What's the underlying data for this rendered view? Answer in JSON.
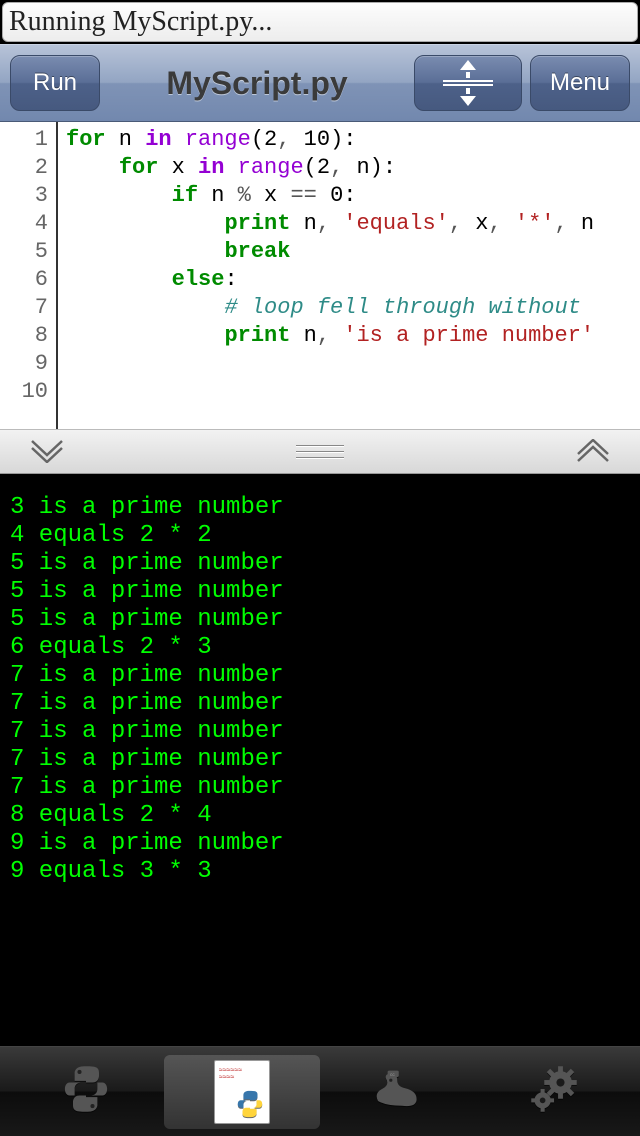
{
  "status_text": "Running MyScript.py...",
  "toolbar": {
    "run_label": "Run",
    "title": "MyScript.py",
    "menu_label": "Menu"
  },
  "editor": {
    "line_count": 10,
    "code_tokens": [
      [
        [
          "kw",
          "for"
        ],
        [
          "",
          " n "
        ],
        [
          "kw2",
          "in"
        ],
        [
          "",
          " "
        ],
        [
          "builtin",
          "range"
        ],
        [
          "",
          "("
        ],
        [
          "num",
          "2"
        ],
        [
          "op",
          ", "
        ],
        [
          "num",
          "10"
        ],
        [
          "",
          "):"
        ]
      ],
      [
        [
          "",
          "    "
        ],
        [
          "kw",
          "for"
        ],
        [
          "",
          " x "
        ],
        [
          "kw2",
          "in"
        ],
        [
          "",
          " "
        ],
        [
          "builtin",
          "range"
        ],
        [
          "",
          "("
        ],
        [
          "num",
          "2"
        ],
        [
          "op",
          ", "
        ],
        [
          "",
          "n):"
        ]
      ],
      [
        [
          "",
          "        "
        ],
        [
          "kw",
          "if"
        ],
        [
          "",
          " n "
        ],
        [
          "op",
          "%"
        ],
        [
          "",
          " x "
        ],
        [
          "op",
          "=="
        ],
        [
          "",
          " "
        ],
        [
          "num",
          "0"
        ],
        [
          "",
          ":"
        ]
      ],
      [
        [
          "",
          "            "
        ],
        [
          "fn",
          "print"
        ],
        [
          "",
          " n"
        ],
        [
          "op",
          ", "
        ],
        [
          "str",
          "'equals'"
        ],
        [
          "op",
          ", "
        ],
        [
          "",
          "x"
        ],
        [
          "op",
          ", "
        ],
        [
          "str",
          "'*'"
        ],
        [
          "op",
          ", "
        ],
        [
          "",
          "n"
        ]
      ],
      [
        [
          "",
          "            "
        ],
        [
          "kw",
          "break"
        ]
      ],
      [
        [
          "",
          "        "
        ],
        [
          "kw",
          "else"
        ],
        [
          "",
          ":"
        ]
      ],
      [
        [
          "",
          "            "
        ],
        [
          "cm",
          "# loop fell through without "
        ]
      ],
      [
        [
          "",
          "            "
        ],
        [
          "fn",
          "print"
        ],
        [
          "",
          " n"
        ],
        [
          "op",
          ", "
        ],
        [
          "str",
          "'is a prime number'"
        ]
      ],
      [
        [
          "",
          ""
        ]
      ],
      [
        [
          "",
          ""
        ]
      ]
    ]
  },
  "console_lines": [
    "3 is a prime number",
    "4 equals 2 * 2",
    "5 is a prime number",
    "5 is a prime number",
    "5 is a prime number",
    "6 equals 2 * 3",
    "7 is a prime number",
    "7 is a prime number",
    "7 is a prime number",
    "7 is a prime number",
    "7 is a prime number",
    "8 equals 2 * 4",
    "9 is a prime number",
    "9 equals 3 * 3"
  ],
  "tabs": [
    {
      "name": "python-tab",
      "icon": "python-icon"
    },
    {
      "name": "file-tab",
      "icon": "document-icon",
      "active": true
    },
    {
      "name": "snake-tab",
      "icon": "snake-icon"
    },
    {
      "name": "settings-tab",
      "icon": "gear-icon"
    }
  ]
}
